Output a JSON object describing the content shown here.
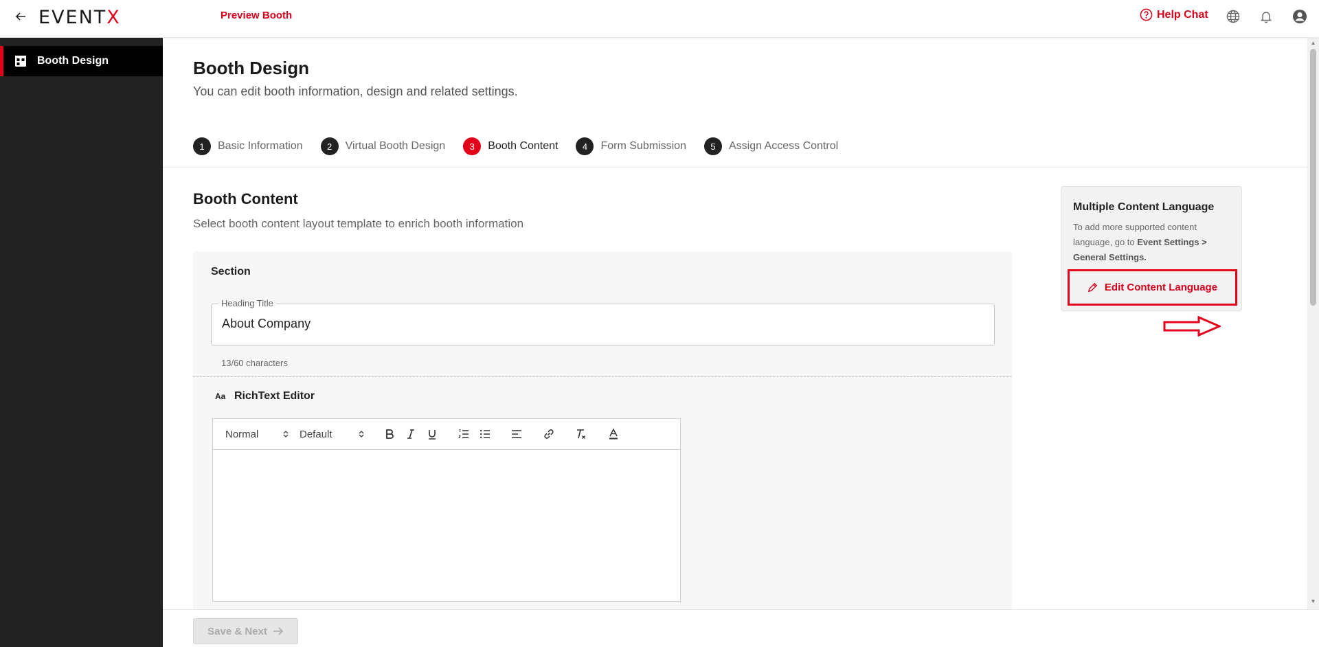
{
  "topbar": {
    "logo_main": "EVENT",
    "logo_x": "X",
    "preview_label": "Preview Booth",
    "help_chat_label": "Help Chat"
  },
  "sidebar": {
    "items": [
      {
        "label": "Booth Design",
        "icon": "booth-grid-icon",
        "active": true
      }
    ]
  },
  "page": {
    "title": "Booth Design",
    "subtitle": "You can edit booth information, design and related settings."
  },
  "steps": [
    {
      "num": "1",
      "label": "Basic Information"
    },
    {
      "num": "2",
      "label": "Virtual Booth Design"
    },
    {
      "num": "3",
      "label": "Booth Content",
      "active": true
    },
    {
      "num": "4",
      "label": "Form Submission"
    },
    {
      "num": "5",
      "label": "Assign Access Control"
    }
  ],
  "content": {
    "title": "Booth Content",
    "subtitle": "Select booth content layout template to enrich booth information",
    "section_label": "Section",
    "heading_field": {
      "legend": "Heading Title",
      "value": "About Company",
      "char_count": "13/60 characters"
    },
    "richtext": {
      "icon_text": "Aa",
      "label": "RichText Editor",
      "format_select": "Normal",
      "font_select": "Default"
    }
  },
  "info_card": {
    "title": "Multiple Content Language",
    "text_prefix": "To add more supported content language, go to ",
    "text_bold": "Event Settings > General Settings.",
    "button_label": "Edit Content Language"
  },
  "footer": {
    "save_next_label": "Save & Next"
  },
  "colors": {
    "accent": "#e3001b",
    "sidebar_bg": "#222222",
    "active_item_bg": "#000000"
  }
}
